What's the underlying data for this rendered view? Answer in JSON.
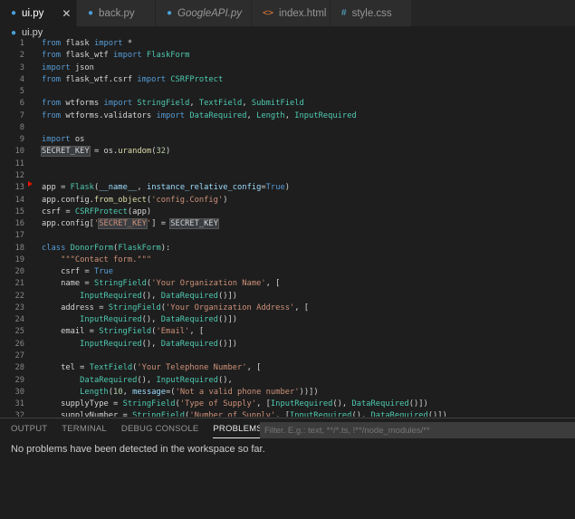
{
  "tabs": [
    {
      "label": "ui.py",
      "icon": "python-icon",
      "active": true
    },
    {
      "label": "back.py",
      "icon": "python-icon"
    },
    {
      "label": "GoogleAPI.py",
      "icon": "python-icon",
      "italic": true
    },
    {
      "label": "index.html",
      "icon": "html-icon"
    },
    {
      "label": "style.css",
      "icon": "css-icon"
    }
  ],
  "close_glyph": "✕",
  "breadcrumb": "ui.py",
  "highlight_word": "SECRET_KEY",
  "lines": [
    "from flask import *",
    "from flask_wtf import FlaskForm",
    "import json",
    "from flask_wtf.csrf import CSRFProtect",
    "",
    "from wtforms import StringField, TextField, SubmitField",
    "from wtforms.validators import DataRequired, Length, InputRequired",
    "",
    "import os",
    "SECRET_KEY = os.urandom(32)",
    "",
    "",
    "app = Flask(__name__, instance_relative_config=True)",
    "app.config.from_object('config.Config')",
    "csrf = CSRFProtect(app)",
    "app.config['SECRET_KEY'] = SECRET_KEY",
    "",
    "class DonorForm(FlaskForm):",
    "    \"\"\"Contact form.\"\"\"",
    "    csrf = True",
    "    name = StringField('Your Organization Name', [",
    "        InputRequired(), DataRequired()])",
    "    address = StringField('Your Organization Address', [",
    "        InputRequired(), DataRequired()])",
    "    email = StringField('Email', [",
    "        InputRequired(), DataRequired()])",
    "",
    "    tel = TextField('Your Telephone Number', [",
    "        DataRequired(), InputRequired(),",
    "        Length(10, message=('Not a valid phone number'))])",
    "    supplyType = StringField('Type of Supply', [InputRequired(), DataRequired()])",
    "    supplyNumber = StringField('Number of Supply', [InputRequired(), DataRequired()])"
  ],
  "panel": {
    "tabs": [
      "OUTPUT",
      "TERMINAL",
      "DEBUG CONSOLE",
      "PROBLEMS"
    ],
    "active_tab": "PROBLEMS",
    "filter_placeholder": "Filter. E.g.: text, **/*.ts, !**/node_modules/**",
    "message": "No problems have been detected in the workspace so far."
  }
}
